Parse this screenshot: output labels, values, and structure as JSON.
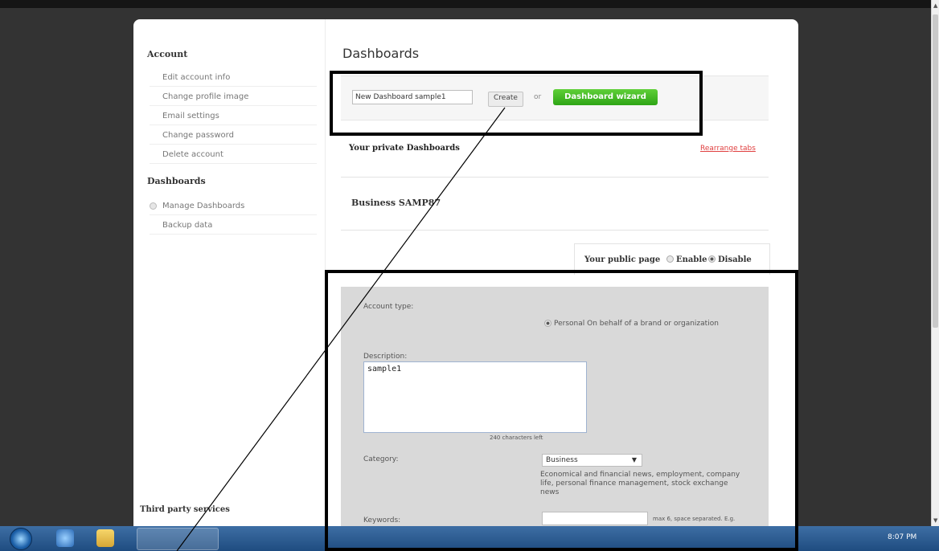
{
  "sidebar": {
    "account_heading": "Account",
    "account_items": [
      {
        "label": "Edit account info"
      },
      {
        "label": "Change profile image"
      },
      {
        "label": "Email settings"
      },
      {
        "label": "Change password"
      },
      {
        "label": "Delete account"
      }
    ],
    "dashboards_heading": "Dashboards",
    "dashboard_items": [
      {
        "label": "Manage Dashboards"
      },
      {
        "label": "Backup data"
      }
    ],
    "third_party_heading": "Third party services"
  },
  "main": {
    "title": "Dashboards",
    "new_dashboard_value": "New Dashboard sample1",
    "create_label": "Create",
    "or_text": "or",
    "wizard_label": "Dashboard wizard",
    "private_label": "Your private Dashboards",
    "rearrange_label": "Rearrange tabs",
    "business_tab": "Business SAMP87",
    "public_page": {
      "label": "Your public page",
      "enable": "Enable",
      "disable": "Disable",
      "selected": "Disable"
    },
    "settings": {
      "account_type_label": "Account type:",
      "account_type_options": "Personal  On behalf of a brand or organization",
      "account_type_selected": "Personal",
      "description_label": "Description:",
      "description_value": "sample1",
      "chars_left": "240 characters left",
      "category_label": "Category:",
      "category_value": "Business",
      "category_description": "Economical and financial news, employment, company life, personal finance management, stock exchange news",
      "keywords_label": "Keywords:",
      "keywords_hint": "max 6, space separated. E.g."
    }
  },
  "taskbar": {
    "clock": "8:07 PM"
  }
}
